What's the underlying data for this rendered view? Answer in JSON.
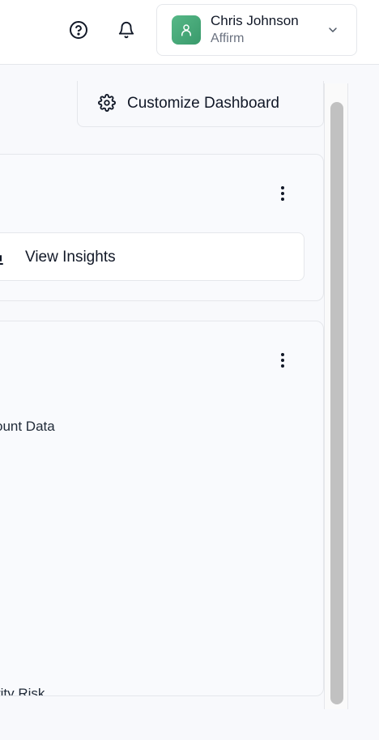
{
  "header": {
    "help_icon": "help-circle-icon",
    "notifications_icon": "bell-icon",
    "user": {
      "name": "Chris Johnson",
      "org": "Affirm",
      "avatar_icon": "user-icon",
      "avatar_color": "#4caf7d"
    }
  },
  "toolbar": {
    "customize_label": "Customize Dashboard",
    "customize_icon": "gear-icon"
  },
  "cards": [
    {
      "menu_icon": "more-vertical-icon",
      "action_label": "View Insights",
      "action_icon": "bar-chart-icon"
    },
    {
      "menu_icon": "more-vertical-icon",
      "items": [
        "ccount Data",
        "curity Risk"
      ]
    }
  ]
}
